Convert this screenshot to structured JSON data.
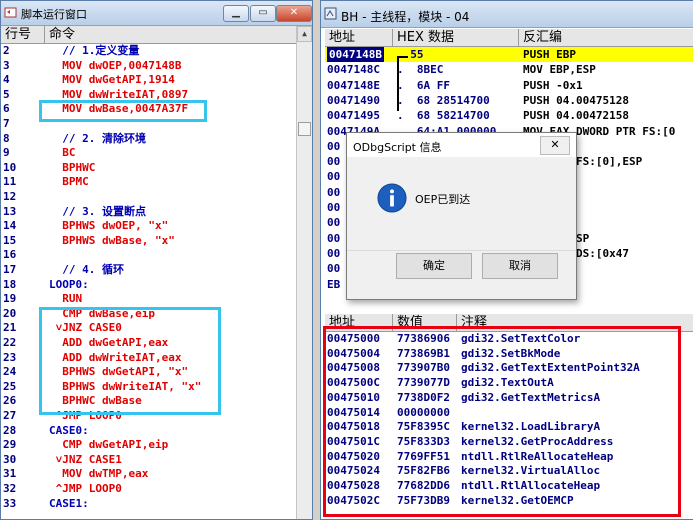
{
  "script_window": {
    "title": "脚本运行窗口",
    "columns": {
      "line": "行号",
      "command": "命令"
    },
    "lines": [
      {
        "n": "2",
        "t": "  // 1.定义变量",
        "c": "#0000b0"
      },
      {
        "n": "3",
        "t": "  MOV dwOEP,0047148B",
        "c": "#e00000"
      },
      {
        "n": "4",
        "t": "  MOV dwGetAPI,1914",
        "c": "#e00000"
      },
      {
        "n": "5",
        "t": "  MOV dwWriteIAT,0897",
        "c": "#e00000"
      },
      {
        "n": "6",
        "t": "  MOV dwBase,0047A37F",
        "c": "#e00000"
      },
      {
        "n": "7",
        "t": "",
        "c": "#000000"
      },
      {
        "n": "8",
        "t": "  // 2. 清除环境",
        "c": "#0000b0"
      },
      {
        "n": "9",
        "t": "  BC",
        "c": "#e00000"
      },
      {
        "n": "10",
        "t": "  BPHWC",
        "c": "#e00000"
      },
      {
        "n": "11",
        "t": "  BPMC",
        "c": "#e00000"
      },
      {
        "n": "12",
        "t": "",
        "c": "#000000"
      },
      {
        "n": "13",
        "t": "  // 3. 设置断点",
        "c": "#0000b0"
      },
      {
        "n": "14",
        "t": "  BPHWS dwOEP, \"x\"",
        "c": "#e00000"
      },
      {
        "n": "15",
        "t": "  BPHWS dwBase, \"x\"",
        "c": "#e00000"
      },
      {
        "n": "16",
        "t": "",
        "c": "#000000"
      },
      {
        "n": "17",
        "t": "  // 4. 循环",
        "c": "#0000b0"
      },
      {
        "n": "18",
        "t": "LOOP0:",
        "c": "#0000b0"
      },
      {
        "n": "19",
        "t": "  RUN",
        "c": "#e00000"
      },
      {
        "n": "20",
        "t": "  CMP dwBase,eip",
        "c": "#e00000"
      },
      {
        "n": "21",
        "t": " ˅JNZ CASE0",
        "c": "#e00000"
      },
      {
        "n": "22",
        "t": "  ADD dwGetAPI,eax",
        "c": "#e00000"
      },
      {
        "n": "23",
        "t": "  ADD dwWriteIAT,eax",
        "c": "#e00000"
      },
      {
        "n": "24",
        "t": "  BPHWS dwGetAPI, \"x\"",
        "c": "#e00000"
      },
      {
        "n": "25",
        "t": "  BPHWS dwWriteIAT, \"x\"",
        "c": "#e00000"
      },
      {
        "n": "26",
        "t": "  BPHWC dwBase",
        "c": "#e00000"
      },
      {
        "n": "27",
        "t": " ^JMP LOOP0",
        "c": "#e00000"
      },
      {
        "n": "28",
        "t": "CASE0:",
        "c": "#0000b0"
      },
      {
        "n": "29",
        "t": "  CMP dwGetAPI,eip",
        "c": "#e00000"
      },
      {
        "n": "30",
        "t": " ˅JNZ CASE1",
        "c": "#e00000"
      },
      {
        "n": "31",
        "t": "  MOV dwTMP,eax",
        "c": "#e00000"
      },
      {
        "n": "32",
        "t": " ^JMP LOOP0",
        "c": "#e00000"
      },
      {
        "n": "33",
        "t": "CASE1:",
        "c": "#0000b0"
      }
    ]
  },
  "cpu_window": {
    "title": "BH - 主线程，模块 - 04",
    "columns": {
      "address": "地址",
      "hex": "HEX 数据",
      "disasm": "反汇编"
    },
    "rows": [
      {
        "addr": "0047148B",
        "hex": "  55",
        "asm": "PUSH EBP"
      },
      {
        "addr": "0047148C",
        "hex": ".  8BEC",
        "asm": "MOV EBP,ESP"
      },
      {
        "addr": "0047148E",
        "hex": ".  6A FF",
        "asm": "PUSH -0x1"
      },
      {
        "addr": "00471490",
        "hex": ".  68 28514700",
        "asm": "PUSH 04.00475128"
      },
      {
        "addr": "00471495",
        "hex": ".  68 58214700",
        "asm": "PUSH 04.00472158"
      },
      {
        "addr": "0047149A",
        "hex": "   64:A1 000000",
        "asm": "MOV EAX,DWORD PTR FS:[0"
      },
      {
        "addr": "00",
        "hex": "",
        "asm": "X"
      },
      {
        "addr": "00",
        "hex": "",
        "asm": "ORD PTR FS:[0],ESP"
      },
      {
        "addr": "00",
        "hex": "",
        "asm": ",0x58"
      },
      {
        "addr": "00",
        "hex": "",
        "asm": "X"
      },
      {
        "addr": "00",
        "hex": "",
        "asm": "I"
      },
      {
        "addr": "00",
        "hex": "",
        "asm": "I"
      },
      {
        "addr": "00",
        "hex": "",
        "asm": "CAL.6],ESP"
      },
      {
        "addr": "00",
        "hex": "",
        "asm": "ORD PTR DS:[0x47"
      },
      {
        "addr": "00",
        "hex": "",
        "asm": ",EDX"
      },
      {
        "addr": "EB",
        "hex": "",
        "asm": ""
      }
    ]
  },
  "dump": {
    "columns": {
      "address": "地址",
      "value": "数值",
      "comment": "注释"
    },
    "rows": [
      {
        "addr": "00475000",
        "val": "77386906",
        "cmt": "gdi32.SetTextColor"
      },
      {
        "addr": "00475004",
        "val": "773869B1",
        "cmt": "gdi32.SetBkMode"
      },
      {
        "addr": "00475008",
        "val": "773907B0",
        "cmt": "gdi32.GetTextExtentPoint32A"
      },
      {
        "addr": "0047500C",
        "val": "7739077D",
        "cmt": "gdi32.TextOutA"
      },
      {
        "addr": "00475010",
        "val": "7738D0F2",
        "cmt": "gdi32.GetTextMetricsA"
      },
      {
        "addr": "00475014",
        "val": "00000000",
        "cmt": ""
      },
      {
        "addr": "00475018",
        "val": "75F8395C",
        "cmt": "kernel32.LoadLibraryA"
      },
      {
        "addr": "0047501C",
        "val": "75F833D3",
        "cmt": "kernel32.GetProcAddress"
      },
      {
        "addr": "00475020",
        "val": "7769FF51",
        "cmt": "ntdll.RtlReAllocateHeap"
      },
      {
        "addr": "00475024",
        "val": "75F82FB6",
        "cmt": "kernel32.VirtualAlloc"
      },
      {
        "addr": "00475028",
        "val": "77682DD6",
        "cmt": "ntdll.RtlAllocateHeap"
      },
      {
        "addr": "0047502C",
        "val": "75F73DB9",
        "cmt": "kernel32.GetOEMCP"
      }
    ]
  },
  "dialog": {
    "title": "ODbgScript 信息",
    "message": "OEP已到达",
    "ok": "确定",
    "cancel": "取消"
  }
}
